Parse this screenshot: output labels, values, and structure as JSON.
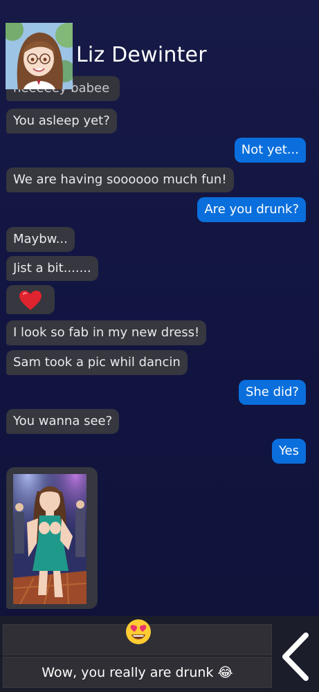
{
  "contact": {
    "name": "Liz Dewinter"
  },
  "messages": [
    {
      "side": "in",
      "text": "heeeeey babee"
    },
    {
      "side": "in",
      "text": "You asleep yet?"
    },
    {
      "side": "out",
      "text": "Not yet..."
    },
    {
      "side": "in",
      "text": "We are having soooooo much fun!"
    },
    {
      "side": "out",
      "text": "Are you drunk?"
    },
    {
      "side": "in",
      "text": "Maybw..."
    },
    {
      "side": "in",
      "text": "Jist a bit......."
    },
    {
      "side": "in",
      "text": "❤️"
    },
    {
      "side": "in",
      "text": "I look so fab in my new dress!"
    },
    {
      "side": "in",
      "text": "Sam took a pic whil dancin"
    },
    {
      "side": "out",
      "text": "She did?"
    },
    {
      "side": "in",
      "text": "You wanna see?"
    },
    {
      "side": "out",
      "text": "Yes"
    }
  ],
  "replies": [
    {
      "text": "😍"
    },
    {
      "text": "Wow, you really are drunk 😂"
    }
  ],
  "colors": {
    "incoming": "#36373f",
    "outgoing": "#0a6fdc",
    "background": "#121541"
  },
  "icons": {
    "back": "chevron-left-icon"
  }
}
